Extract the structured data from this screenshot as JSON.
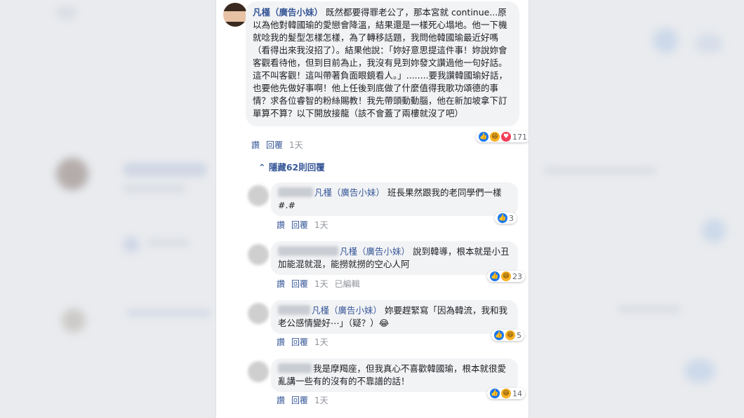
{
  "main_comment": {
    "author": "凡槿（廣告小妹）",
    "text": "既然都要得罪老公了，那本宮就 continue...原以為他對韓國瑜的愛戀會降溫，結果還是一樣死心塌地。他一下機就唸我的髮型怎樣怎樣，為了轉移話題，我問他韓國瑜最近好嗎（看得出來我沒招了）。結果他說：「妳好意思提這件事！妳說妳會客觀看待他，但到目前為止，我沒有見到妳發文讚過他一句好話。這不叫客觀！這叫帶著負面眼鏡看人。」........要我讚韓國瑜好話，也要他先做好事啊！他上任後到底做了什麼值得我歌功頌德的事情？求各位睿智的粉絲賜教！我先帶頭動動腦，他在新加坡拿下訂單算不算？以下開放接龍（該不會蓋了兩樓就沒了吧）",
    "reaction_count": "171",
    "like_label": "讚",
    "reply_label": "回覆",
    "time": "1天"
  },
  "hide_replies": "隱藏62則回覆",
  "replies": [
    {
      "tag": "凡槿（廣告小妹）",
      "text": "班長果然跟我的老同學們一樣#.#",
      "count": "3",
      "like_label": "讚",
      "reply_label": "回覆",
      "time": "1天",
      "edited": ""
    },
    {
      "tag": "凡槿（廣告小妹）",
      "text": "說到韓導，根本就是小丑加能混就混，能撈就撈的空心人阿",
      "count": "23",
      "like_label": "讚",
      "reply_label": "回覆",
      "time": "1天",
      "edited": "已編輯"
    },
    {
      "tag": "凡槿（廣告小妹）",
      "text": "妳要趕緊寫「因為韓流，我和我老公感情變好⋯」（疑？）😂",
      "count": "5",
      "like_label": "讚",
      "reply_label": "回覆",
      "time": "1天",
      "edited": ""
    },
    {
      "tag": "",
      "text": "我是摩羯座，但我真心不喜歡韓國瑜，根本就很愛亂講一些有的沒有的不靠譜的話！",
      "count": "14",
      "like_label": "讚",
      "reply_label": "回覆",
      "time": "1天",
      "edited": ""
    }
  ],
  "icons": {
    "like": "like-icon",
    "haha": "haha-icon",
    "love": "love-icon",
    "chevron": "chevron-up-icon"
  },
  "colors": {
    "link": "#385898",
    "bubble": "#f2f3f5",
    "like": "#1877f2",
    "haha": "#f7b125",
    "love": "#f33e58"
  }
}
